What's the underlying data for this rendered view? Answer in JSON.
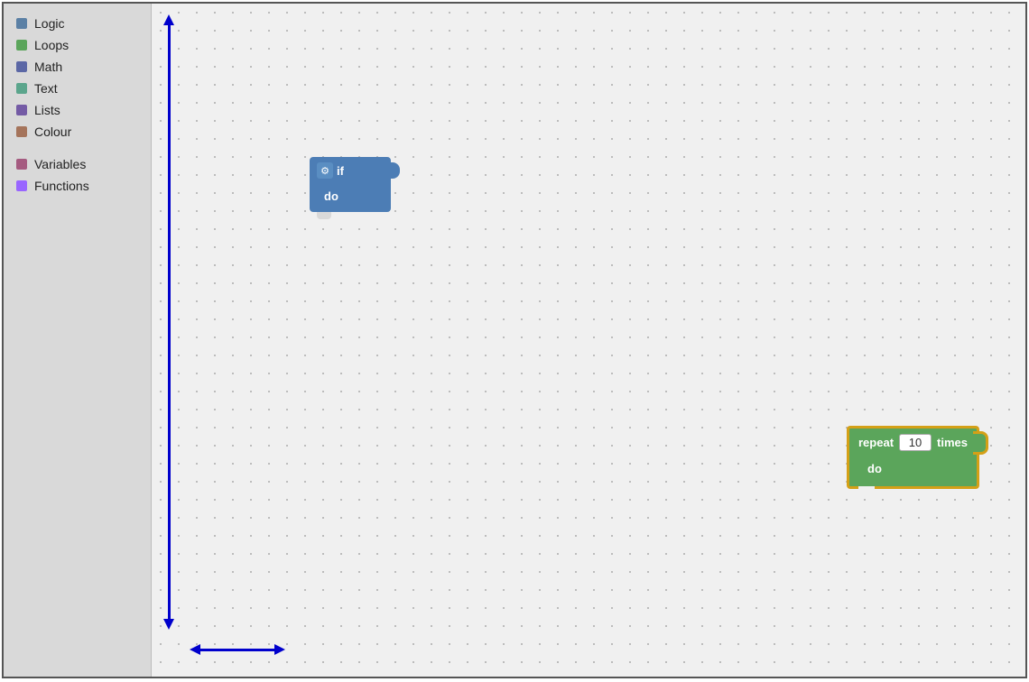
{
  "sidebar": {
    "items": [
      {
        "label": "Logic",
        "color": "#5b80a5"
      },
      {
        "label": "Loops",
        "color": "#5ba55b"
      },
      {
        "label": "Math",
        "color": "#5b67a5"
      },
      {
        "label": "Text",
        "color": "#5ba58c"
      },
      {
        "label": "Lists",
        "color": "#745ba5"
      },
      {
        "label": "Colour",
        "color": "#a5745b"
      },
      {
        "label": "Variables",
        "color": "#a55b80"
      },
      {
        "label": "Functions",
        "color": "#9966ff"
      }
    ]
  },
  "blocks": {
    "if_block": {
      "top_label": "if",
      "bottom_label": "do",
      "gear_icon": "⚙"
    },
    "repeat_block": {
      "top_label_1": "repeat",
      "top_label_2": "times",
      "bottom_label": "do",
      "value": "10"
    }
  },
  "arrows": {
    "vertical": true,
    "horizontal": true
  }
}
